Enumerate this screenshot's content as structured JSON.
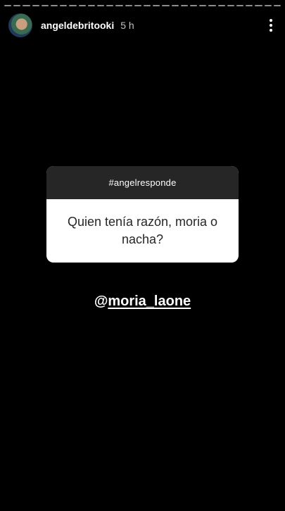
{
  "story": {
    "segments": 30,
    "username": "angeldebritooki",
    "time": "5 h",
    "more_icon": "more-vertical-icon"
  },
  "question_box": {
    "header": "#angelresponde",
    "question": "Quien tenía razón, moria o nacha?"
  },
  "mention": {
    "at": "@",
    "handle": "moria_laone"
  }
}
